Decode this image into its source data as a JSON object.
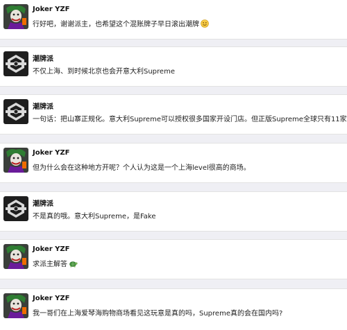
{
  "messages": [
    {
      "author": "Joker YZF",
      "avatar": "joker-avatar",
      "text": "行好吧，谢谢派主，也希望这个混账牌子早日滚出潮牌",
      "emoji": "smile-emoji"
    },
    {
      "author": "潮牌派",
      "avatar": "chaopaipai-logo-avatar",
      "text": "不仅上海、到时候北京也会开意大利Supreme",
      "emoji": ""
    },
    {
      "author": "潮牌派",
      "avatar": "chaopaipai-logo-avatar",
      "text": "一句话：把山寨正规化。意大利Supreme可以授权很多国家开设门店。但正版Supreme全球只有11家。",
      "emoji": ""
    },
    {
      "author": "Joker YZF",
      "avatar": "joker-avatar",
      "text": "但为什么会在这种地方开呢？个人认为这是一个上海level很高的商场。",
      "emoji": ""
    },
    {
      "author": "潮牌派",
      "avatar": "chaopaipai-logo-avatar",
      "text": "不是真的哦。意大利Supreme，是Fake",
      "emoji": ""
    },
    {
      "author": "Joker YZF",
      "avatar": "joker-avatar",
      "text": "求派主解答",
      "emoji": "turtle-emoji"
    },
    {
      "author": "Joker YZF",
      "avatar": "joker-avatar",
      "text": "我一哥们在上海爱琴海购物商场看见这玩意是真的吗，Supreme真的会在国内吗?",
      "emoji": ""
    }
  ],
  "colors": {
    "background": "#efeff4",
    "card": "#ffffff",
    "author_text": "#111111",
    "message_text": "#222222"
  }
}
